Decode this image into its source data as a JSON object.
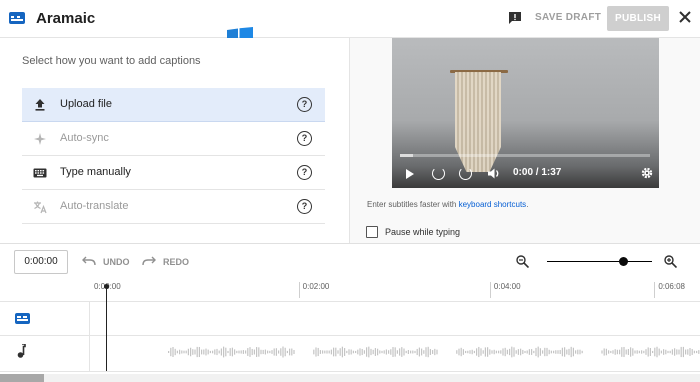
{
  "header": {
    "title": "Aramaic",
    "save_draft": "SAVE DRAFT",
    "publish": "PUBLISH"
  },
  "left_panel": {
    "instruction": "Select how you want to add captions",
    "options": [
      {
        "label": "Upload file",
        "selected": true,
        "enabled": true,
        "icon": "upload-icon"
      },
      {
        "label": "Auto-sync",
        "selected": false,
        "enabled": false,
        "icon": "sparkle-icon"
      },
      {
        "label": "Type manually",
        "selected": false,
        "enabled": true,
        "icon": "keyboard-icon"
      },
      {
        "label": "Auto-translate",
        "selected": false,
        "enabled": false,
        "icon": "translate-icon"
      }
    ],
    "help_glyph": "?"
  },
  "player": {
    "time": "0:00 / 1:37",
    "progress": 0.05
  },
  "hint": {
    "prefix": "Enter subtitles faster with ",
    "link": "keyboard shortcuts",
    "suffix": "."
  },
  "pause_while_typing": {
    "label": "Pause while typing",
    "checked": false
  },
  "toolbar": {
    "timecode": "0:00:00",
    "undo": "UNDO",
    "redo": "REDO",
    "zoom_level": 0.72
  },
  "timeline": {
    "ticks": [
      {
        "label": "0:00:00",
        "fraction": 0.0
      },
      {
        "label": "0:02:00",
        "fraction": 0.341
      },
      {
        "label": "0:04:00",
        "fraction": 0.655
      },
      {
        "label": "0:06:08",
        "fraction": 0.925
      }
    ]
  },
  "colors": {
    "accent": "#065fd4",
    "caption_icon": "#1565c0",
    "selected_row": "#e3ecfa",
    "publish_disabled": "#cfcfcf"
  }
}
